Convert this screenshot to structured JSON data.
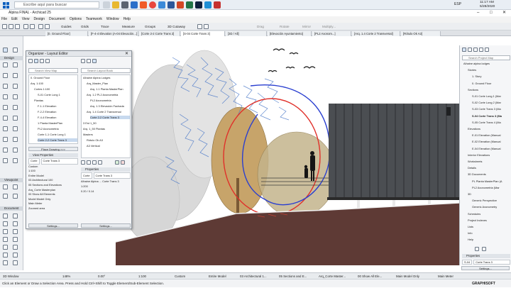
{
  "taskbar": {
    "search_placeholder": "Escribe aquí para buscar",
    "lang": "ESP",
    "time": "11:17 AM",
    "date": "5/28/2020"
  },
  "window": {
    "title": "Alpina FINAL - Archicad 25"
  },
  "menu": [
    "File",
    "Edit",
    "View",
    "Design",
    "Document",
    "Options",
    "Teamwork",
    "Window",
    "Help"
  ],
  "toolbar": {
    "guides": "Guides",
    "grids": "Grids",
    "trace": "Trace",
    "measure": "Measure",
    "groups": "Groups",
    "cutaway": "3D Cutaway",
    "drag": "Drag",
    "rotate": "Rotate",
    "mirror": "Mirror",
    "multiply": "Multiply..."
  },
  "tabs": [
    {
      "label": "[0. Ground Floor]",
      "active": false
    },
    {
      "label": "[F-4-4 Elevation (A-04 Elevación...]",
      "active": false
    },
    {
      "label": "[Corte 2-2 Corte Trans 2]",
      "active": false
    },
    {
      "label": "[S-04 Corte Trans 3]",
      "active": true
    },
    {
      "label": "[3D / All]",
      "active": false
    },
    {
      "label": "[Elevación Ayuntamiento]",
      "active": false
    },
    {
      "label": "[PL2 Axonom...]",
      "active": false
    },
    {
      "label": "[Arq. 1.4 Corte 2 Transversal]",
      "active": false
    },
    {
      "label": "[Rótulo Ok A3]",
      "active": false
    }
  ],
  "toolbox": {
    "design": "Design",
    "viewpoint": "Viewpoint",
    "document": "Document"
  },
  "organizer": {
    "title": "Organizer - Layout Editor",
    "left_search": "Search View Map",
    "right_search": "Search Layout Book",
    "left_items": [
      {
        "label": "0. Ground Floor",
        "sel": false
      },
      {
        "label": "Arq. 1:100",
        "sel": false
      },
      {
        "label": "Cortes 1:100",
        "sel": false
      },
      {
        "label": "S-01 Corte Long 1",
        "sel": false
      },
      {
        "label": "Plantas",
        "sel": false
      },
      {
        "label": "F-1-1 Elevation",
        "sel": false
      },
      {
        "label": "F-2-2 Elevation",
        "sel": false
      },
      {
        "label": "F-4-4 Elevation",
        "sel": false
      },
      {
        "label": "1 Planta MasterPlan",
        "sel": false
      },
      {
        "label": "PL2 Axonometria",
        "sel": false
      },
      {
        "label": "Corte 1-1 Corte Long 1",
        "sel": false
      },
      {
        "label": "Corte 2-2 Corte Trans 3",
        "sel": true
      }
    ],
    "right_items": [
      {
        "label": "Alhaine Alpina Lodges",
        "sel": false
      },
      {
        "label": "Arq_Master_Plan",
        "sel": false
      },
      {
        "label": "Arq. 1.1 Planta MasterPlan",
        "sel": false
      },
      {
        "label": "Arq. 1.2 PL2 Axonometria",
        "sel": false
      },
      {
        "label": "PL2 Axonometria",
        "sel": false
      },
      {
        "label": "Arq. 1.3 Elevación Fachada",
        "sel": false
      },
      {
        "label": "Arq. 1.4 Corte 2 Transversal",
        "sel": false
      },
      {
        "label": "Corte 2-2 Corte Trans 3",
        "sel": true
      },
      {
        "label": "3 Est 1_50",
        "sel": false
      },
      {
        "label": "Arq. 1_50 Plantas",
        "sel": false
      },
      {
        "label": "Masters",
        "sel": false
      },
      {
        "label": "Rótulo Ok A3",
        "sel": false
      },
      {
        "label": "A3 Vertical",
        "sel": false
      }
    ],
    "place_drawing": "Place Drawing >>>",
    "view_properties": "View Properties",
    "view_id": "Corte",
    "view_name": "Corte Trans 3",
    "custom": "Custom",
    "scale": "1:100",
    "entire_model": "Entire Model",
    "pen_set": "03 Architectural 100",
    "mvo": "05 Sections and Elevations",
    "ren": "Arq_Corte Masterplan",
    "layer_comb": "00 Show All Elements",
    "model_only": "Model Model Only",
    "meter": "Main Meter",
    "zoomed": "Zoomed area",
    "settings": "Settings...",
    "properties": "Properties",
    "prop_id": "Corte",
    "prop_name": "Corte Trans 3",
    "prop_path": "Alhaine Alpina ... Corte Trans 3",
    "prop_scale": "1:200",
    "prop_size": "0.20 / 0.14",
    "settings2": "Settings..."
  },
  "navigator": {
    "search": "Search Project Map",
    "items": [
      {
        "label": "Alhaine alpina lodges",
        "indent": 0,
        "bold": false
      },
      {
        "label": "Stories",
        "indent": 1,
        "bold": false
      },
      {
        "label": "1. Story",
        "indent": 2,
        "bold": false
      },
      {
        "label": "0. Ground Floor",
        "indent": 2,
        "bold": false
      },
      {
        "label": "Sections",
        "indent": 1,
        "bold": false
      },
      {
        "label": "S-01 Corte Long 1 (Mar",
        "indent": 2,
        "bold": false
      },
      {
        "label": "S-02 Corte Long 2 (Mar",
        "indent": 2,
        "bold": false
      },
      {
        "label": "S-03 Corte Trans 3 (Ma",
        "indent": 2,
        "bold": false
      },
      {
        "label": "S-04 Corte Trans 3 (Ma",
        "indent": 2,
        "bold": true
      },
      {
        "label": "S-05 Corte Trans 4 (Ma",
        "indent": 2,
        "bold": false
      },
      {
        "label": "Elevations",
        "indent": 1,
        "bold": false
      },
      {
        "label": "E-01 Elevation (Manual",
        "indent": 2,
        "bold": false
      },
      {
        "label": "E-02 Elevation (Manual",
        "indent": 2,
        "bold": false
      },
      {
        "label": "E-04 Elevation (Manual",
        "indent": 2,
        "bold": false
      },
      {
        "label": "Interior Elevations",
        "indent": 1,
        "bold": false
      },
      {
        "label": "Worksheets",
        "indent": 1,
        "bold": false
      },
      {
        "label": "Details",
        "indent": 1,
        "bold": false
      },
      {
        "label": "3D Documents",
        "indent": 1,
        "bold": false
      },
      {
        "label": "PL Planta MasterPlan (A",
        "indent": 2,
        "bold": false
      },
      {
        "label": "PL2 Axonometria (Mar",
        "indent": 2,
        "bold": false
      },
      {
        "label": "3D",
        "indent": 1,
        "bold": false
      },
      {
        "label": "Generic Perspective",
        "indent": 2,
        "bold": false
      },
      {
        "label": "Generic Axonometry",
        "indent": 2,
        "bold": false
      },
      {
        "label": "Schedules",
        "indent": 1,
        "bold": false
      },
      {
        "label": "Project Indexes",
        "indent": 1,
        "bold": false
      },
      {
        "label": "Lists",
        "indent": 1,
        "bold": false
      },
      {
        "label": "Info",
        "indent": 1,
        "bold": false
      },
      {
        "label": "Help",
        "indent": 1,
        "bold": false
      }
    ],
    "properties": "Properties",
    "prop_id": "S-04",
    "prop_name": "Corte Trans 3",
    "settings": "Settings..."
  },
  "infobar": {
    "window_label": "3D Window",
    "zoom": "148%",
    "angle": "0.00°",
    "scale": "1:100",
    "custom": "Custom",
    "model": "Entire Model",
    "pen": "03 Architectural 1...",
    "mvo": "05 Sections and E...",
    "ren": "Arq_Corte Master...",
    "layers": "00 Show All Ele...",
    "model_only": "Main Model Only",
    "meter": "Main Meter"
  },
  "status": {
    "hint": "Click an Element or Draw a Selection Area. Press and Hold Ctrl+Shift to Toggle Element/Sub-Element Selection.",
    "brand": "GRAPHISOFT"
  },
  "colors": {
    "ground": "#5e3a35",
    "annotation_red": "#e0302a",
    "annotation_blue": "#2a3fd0",
    "building": "#4b4e52",
    "sky_scribble": "#4a78c8"
  }
}
